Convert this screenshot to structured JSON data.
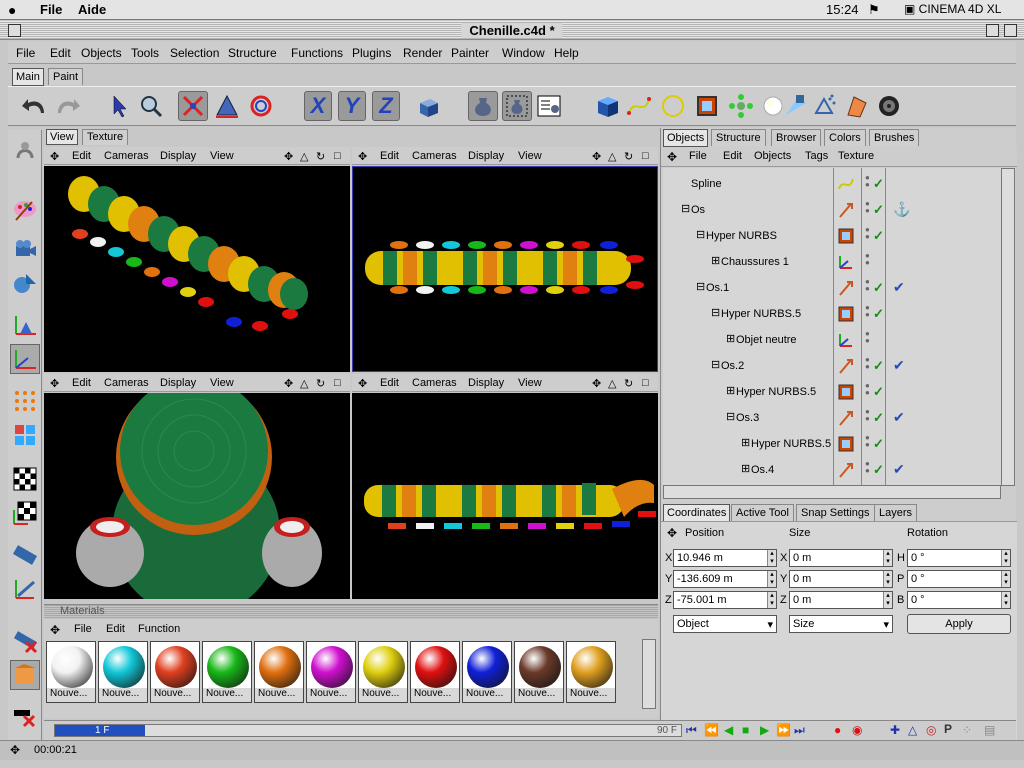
{
  "mac_menu": {
    "file": "File",
    "aide": "Aide",
    "clock": "15:24",
    "app": "CINEMA 4D XL"
  },
  "window": {
    "title": "Chenille.c4d *"
  },
  "menu": [
    "File",
    "Edit",
    "Objects",
    "Tools",
    "Selection",
    "Structure",
    "Functions",
    "Plugins",
    "Render",
    "Painter",
    "Window",
    "Help"
  ],
  "top_tabs": [
    "Main",
    "Paint"
  ],
  "view_tabs": [
    "View",
    "Texture"
  ],
  "viewport_menu": [
    "Edit",
    "Cameras",
    "Display",
    "View"
  ],
  "right_tabs": [
    "Objects",
    "Structure",
    "Browser",
    "Colors",
    "Brushes"
  ],
  "objects_menu": [
    "File",
    "Edit",
    "Objects",
    "Tags",
    "Texture"
  ],
  "objects": [
    {
      "name": "Spline",
      "indent": 0,
      "expander": "",
      "has_tag": false
    },
    {
      "name": "Os",
      "indent": 0,
      "expander": "⊟",
      "has_tag": true,
      "tag_icon": "anchor"
    },
    {
      "name": "Hyper NURBS",
      "indent": 1,
      "expander": "⊟",
      "has_tag": false
    },
    {
      "name": "Chaussures 1",
      "indent": 2,
      "expander": "⊞",
      "has_tag": false
    },
    {
      "name": "Os.1",
      "indent": 1,
      "expander": "⊟",
      "has_tag": true,
      "tag_icon": "ik"
    },
    {
      "name": "Hyper NURBS.5",
      "indent": 2,
      "expander": "⊟",
      "has_tag": false
    },
    {
      "name": "Objet neutre",
      "indent": 3,
      "expander": "⊞",
      "has_tag": false
    },
    {
      "name": "Os.2",
      "indent": 2,
      "expander": "⊟",
      "has_tag": true,
      "tag_icon": "ik"
    },
    {
      "name": "Hyper NURBS.5",
      "indent": 3,
      "expander": "⊞",
      "has_tag": false
    },
    {
      "name": "Os.3",
      "indent": 3,
      "expander": "⊟",
      "has_tag": true,
      "tag_icon": "ik"
    },
    {
      "name": "Hyper NURBS.5",
      "indent": 4,
      "expander": "⊞",
      "has_tag": false
    },
    {
      "name": "Os.4",
      "indent": 4,
      "expander": "⊞",
      "has_tag": true,
      "tag_icon": "ik"
    }
  ],
  "coord_tabs": [
    "Coordinates",
    "Active Tool",
    "Snap Settings",
    "Layers"
  ],
  "coords": {
    "heading_position": "Position",
    "heading_size": "Size",
    "heading_rotation": "Rotation",
    "px_label": "X",
    "py_label": "Y",
    "pz_label": "Z",
    "sx_label": "X",
    "sy_label": "Y",
    "sz_label": "Z",
    "rh_label": "H",
    "rp_label": "P",
    "rb_label": "B",
    "px": "10.946 m",
    "py": "-136.609 m",
    "pz": "-75.001 m",
    "sx": "0 m",
    "sy": "0 m",
    "sz": "0 m",
    "rh": "0 °",
    "rp": "0 °",
    "rb": "0 °",
    "mode_select": "Object",
    "size_select": "Size",
    "apply": "Apply"
  },
  "materials": {
    "title": "Materials",
    "menu": [
      "File",
      "Edit",
      "Function"
    ],
    "items": [
      {
        "label": "Nouve...",
        "color": "#f2f2f2"
      },
      {
        "label": "Nouve...",
        "color": "#12c8d8"
      },
      {
        "label": "Nouve...",
        "color": "#e04020"
      },
      {
        "label": "Nouve...",
        "color": "#18b818"
      },
      {
        "label": "Nouve...",
        "color": "#e07010"
      },
      {
        "label": "Nouve...",
        "color": "#d010d0"
      },
      {
        "label": "Nouve...",
        "color": "#e0d010"
      },
      {
        "label": "Nouve...",
        "color": "#e01010"
      },
      {
        "label": "Nouve...",
        "color": "#1020d8"
      },
      {
        "label": "Nouve...",
        "color": "#6a3a2a"
      },
      {
        "label": "Nouve...",
        "color": "#e0a020"
      }
    ]
  },
  "timeline": {
    "current_frame": "1 F",
    "end_frame": "90 F"
  },
  "status": {
    "time": "00:00:21"
  }
}
